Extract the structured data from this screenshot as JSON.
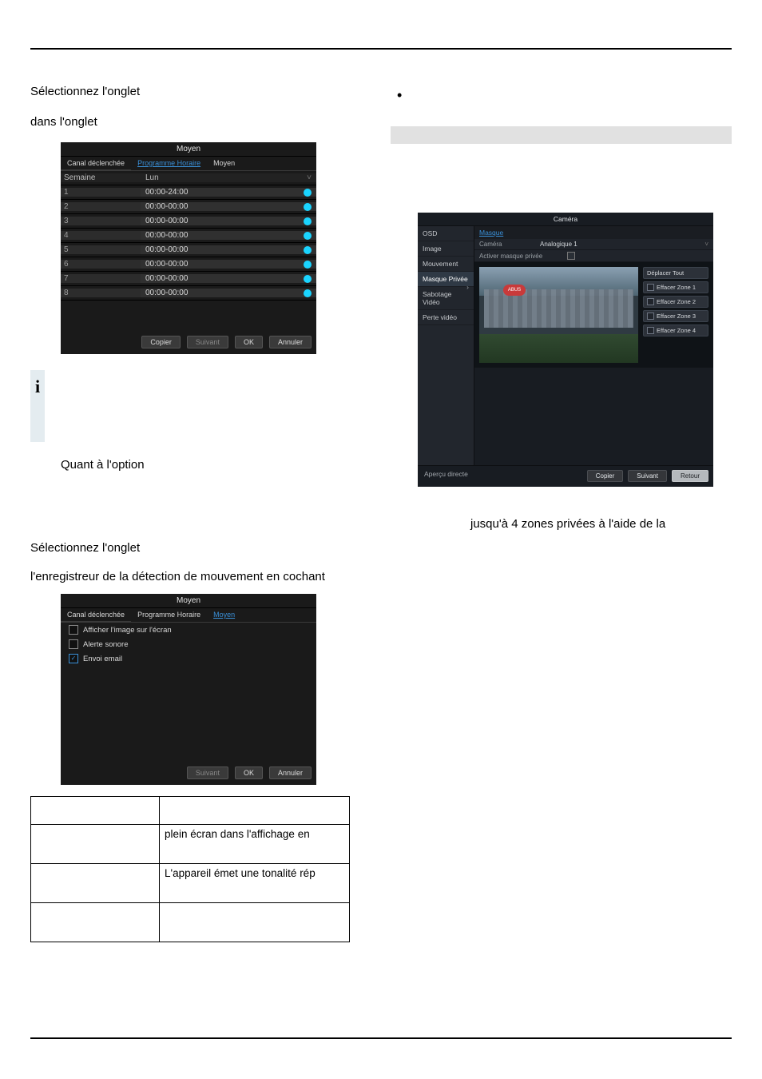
{
  "intro": {
    "line1": "Sélectionnez l'onglet",
    "line2": "dans l'onglet",
    "info_symbol": "i",
    "option_line": "Quant à l'option",
    "lower_select": "Sélectionnez l'onglet",
    "lower_line2": "l'enregistreur de la détection de mouvement en cochant"
  },
  "ui_schedule": {
    "title": "Moyen",
    "tab_fixed": "Canal déclenchée",
    "tab_active": "Programme Horaire",
    "tab_other": "Moyen",
    "header_left": "Semaine",
    "header_value": "Lun",
    "rows": [
      {
        "num": "1",
        "range": "00:00-24:00"
      },
      {
        "num": "2",
        "range": "00:00-00:00"
      },
      {
        "num": "3",
        "range": "00:00-00:00"
      },
      {
        "num": "4",
        "range": "00:00-00:00"
      },
      {
        "num": "5",
        "range": "00:00-00:00"
      },
      {
        "num": "6",
        "range": "00:00-00:00"
      },
      {
        "num": "7",
        "range": "00:00-00:00"
      },
      {
        "num": "8",
        "range": "00:00-00:00"
      }
    ],
    "btn_copy": "Copier",
    "btn_next": "Suivant",
    "btn_ok": "OK",
    "btn_cancel": "Annuler"
  },
  "ui_moyen": {
    "title": "Moyen",
    "tab_fixed": "Canal déclenchée",
    "tab_mid": "Programme Horaire",
    "tab_active": "Moyen",
    "opts": {
      "show": "Afficher l'image sur l'écran",
      "beep": "Alerte sonore",
      "email": "Envoi email"
    },
    "btn_next": "Suivant",
    "btn_ok": "OK",
    "btn_cancel": "Annuler"
  },
  "desc_table": {
    "r2_c2": "plein écran dans l'affichage en",
    "r3_c2": "L'appareil émet une tonalité rép"
  },
  "right": {
    "masque_line": "jusqu'à 4 zones privées à l'aide de la"
  },
  "camera": {
    "title": "Caméra",
    "side": {
      "osd": "OSD",
      "image": "Image",
      "mouv": "Mouvement",
      "masque": "Masque Privée",
      "sabotage": "Sabotage Vidéo",
      "perte": "Perte vidéo"
    },
    "sub": "Masque",
    "row_cam": "Caméra",
    "row_cam_val": "Analogique 1",
    "row_enable": "Activer masque privée",
    "actions": {
      "all": "Déplacer Tout",
      "z1": "Effacer Zone 1",
      "z2": "Effacer Zone 2",
      "z3": "Effacer Zone 3",
      "z4": "Effacer Zone 4"
    },
    "building_sign": "ABUS",
    "foot_left": "Aperçu directe",
    "btn_copy": "Copier",
    "btn_next": "Suivant",
    "btn_back": "Retour"
  }
}
